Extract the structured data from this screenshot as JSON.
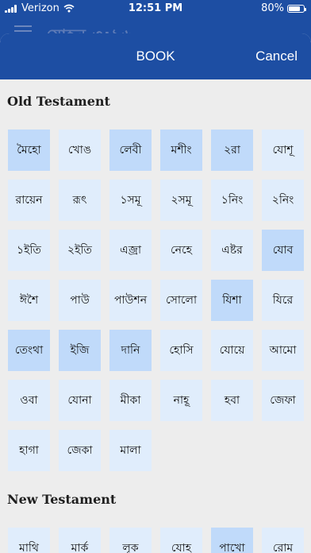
{
  "status": {
    "carrier": "Verizon",
    "time": "12:51 PM",
    "battery": "80%",
    "battery_level": 0.8
  },
  "background": {
    "title_partial": "যোহন ৩:১৬"
  },
  "header": {
    "title": "BOOK",
    "cancel_label": "Cancel"
  },
  "old_testament": {
    "title": "Old Testament",
    "books": [
      "মৈহো",
      "খোঙ",
      "লেবী",
      "মশীং",
      "২রা",
      "যোশূ",
      "রায়েন",
      "রূৎ",
      "১সমূ",
      "২সমূ",
      "১নিং",
      "২নিং",
      "১ইতি",
      "২ইতি",
      "এজ্রা",
      "নেহে",
      "এষ্টর",
      "যোব",
      "ঈশৈ",
      "পাউ",
      "পাউশন",
      "সোলো",
      "যিশা",
      "যিরে",
      "তেংথা",
      "ইজি",
      "দানি",
      "হোসি",
      "যোয়ে",
      "আমো",
      "ওবা",
      "যোনা",
      "মীকা",
      "নাহূ",
      "হবা",
      "জেফা",
      "হাগা",
      "জেকা",
      "মালা"
    ]
  },
  "new_testament": {
    "title": "New Testament",
    "books": [
      "মাথি",
      "মার্ক",
      "লূক",
      "যোহ",
      "পাখো",
      "রোম"
    ]
  },
  "colors": {
    "header": "#1d4ea3",
    "tile_light": "#e0edfc",
    "tile_mid": "#d4e6fb",
    "tile_dark": "#c0dafa",
    "sheet_bg": "#ededed"
  }
}
